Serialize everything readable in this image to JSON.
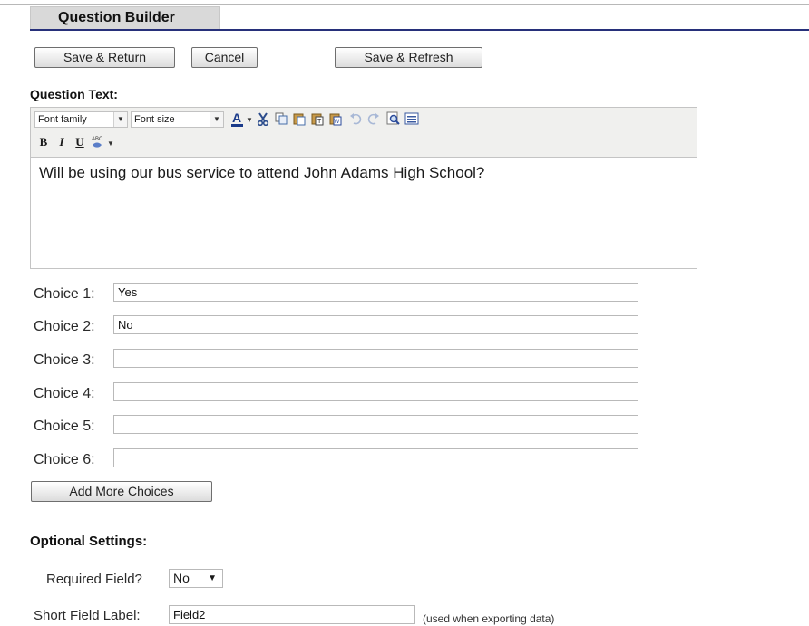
{
  "header": {
    "title": "Question Builder"
  },
  "actions": {
    "save_return": "Save & Return",
    "cancel": "Cancel",
    "save_refresh": "Save & Refresh"
  },
  "question_text": {
    "label": "Question Text:",
    "toolbar": {
      "font_family": "Font family",
      "font_size": "Font size",
      "icons": [
        "text-color-icon",
        "cut-icon",
        "copy-icon",
        "paste-icon",
        "paste-text-icon",
        "paste-word-icon",
        "undo-icon",
        "redo-icon",
        "find-icon",
        "select-all-icon",
        "bold-icon",
        "italic-icon",
        "underline-icon",
        "spellcheck-icon"
      ]
    },
    "value": "Will be using our bus service to attend John Adams High School?"
  },
  "choices": [
    {
      "label": "Choice 1:",
      "value": "Yes"
    },
    {
      "label": "Choice 2:",
      "value": "No"
    },
    {
      "label": "Choice 3:",
      "value": ""
    },
    {
      "label": "Choice 4:",
      "value": ""
    },
    {
      "label": "Choice 5:",
      "value": ""
    },
    {
      "label": "Choice 6:",
      "value": ""
    }
  ],
  "add_more_label": "Add More Choices",
  "optional": {
    "heading": "Optional Settings:",
    "required_label": "Required Field?",
    "required_value": "No",
    "short_label": "Short Field Label:",
    "short_value": "Field2",
    "short_hint": "(used when exporting data)"
  },
  "colors": {
    "header_rule": "#27307a",
    "header_tab": "#d9d9d9"
  }
}
